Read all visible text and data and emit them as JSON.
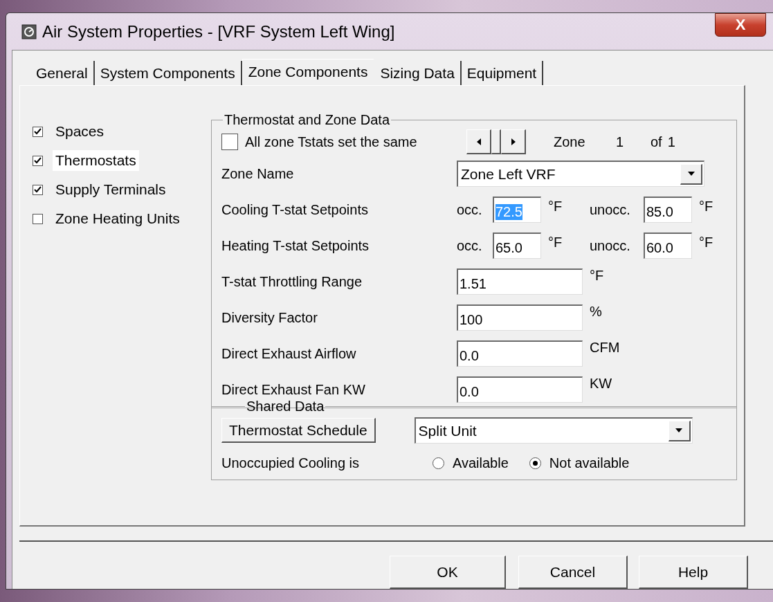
{
  "window": {
    "title": "Air System Properties - [VRF System Left Wing]",
    "close": "X"
  },
  "tabs": [
    {
      "label": "General",
      "selected": false
    },
    {
      "label": "System Components",
      "selected": false
    },
    {
      "label": "Zone Components",
      "selected": true
    },
    {
      "label": "Sizing Data",
      "selected": false
    },
    {
      "label": "Equipment",
      "selected": false
    }
  ],
  "components": [
    {
      "label": "Spaces",
      "checked": true,
      "focused": false
    },
    {
      "label": "Thermostats",
      "checked": true,
      "focused": true
    },
    {
      "label": "Supply Terminals",
      "checked": true,
      "focused": false
    },
    {
      "label": "Zone Heating Units",
      "checked": false,
      "focused": false
    }
  ],
  "thermostat_group": {
    "title": "Thermostat and Zone Data",
    "all_same": {
      "label": "All zone Tstats set the same",
      "checked": false
    },
    "zone_nav": {
      "label": "Zone",
      "number": "1",
      "of": "of",
      "total": "1"
    },
    "zone_name": {
      "label": "Zone Name",
      "value": "Zone Left VRF"
    },
    "setpoints": [
      {
        "label": "Cooling T-stat Setpoints",
        "occ_label": "occ.",
        "occ_value": "72.5",
        "occ_highlighted": true,
        "occ_unit": "°F",
        "unocc_label": "unocc.",
        "unocc_value": "85.0",
        "unocc_unit": "°F"
      },
      {
        "label": "Heating T-stat Setpoints",
        "occ_label": "occ.",
        "occ_value": "65.0",
        "occ_highlighted": false,
        "occ_unit": "°F",
        "unocc_label": "unocc.",
        "unocc_value": "60.0",
        "unocc_unit": "°F"
      }
    ],
    "fields": [
      {
        "label": "T-stat Throttling Range",
        "value": "1.51",
        "unit": "°F"
      },
      {
        "label": "Diversity Factor",
        "value": "100",
        "unit": "%"
      },
      {
        "label": "Direct Exhaust Airflow",
        "value": "0.0",
        "unit": "CFM"
      },
      {
        "label": "Direct Exhaust Fan KW",
        "value": "0.0",
        "unit": "KW"
      }
    ]
  },
  "shared_group": {
    "title": "Shared Data",
    "schedule_button": "Thermostat Schedule",
    "schedule_value": "Split Unit",
    "unoccupied": {
      "label": "Unoccupied Cooling is",
      "options": [
        {
          "label": "Available",
          "selected": false
        },
        {
          "label": "Not available",
          "selected": true
        }
      ]
    }
  },
  "buttons": [
    "OK",
    "Cancel",
    "Help"
  ]
}
